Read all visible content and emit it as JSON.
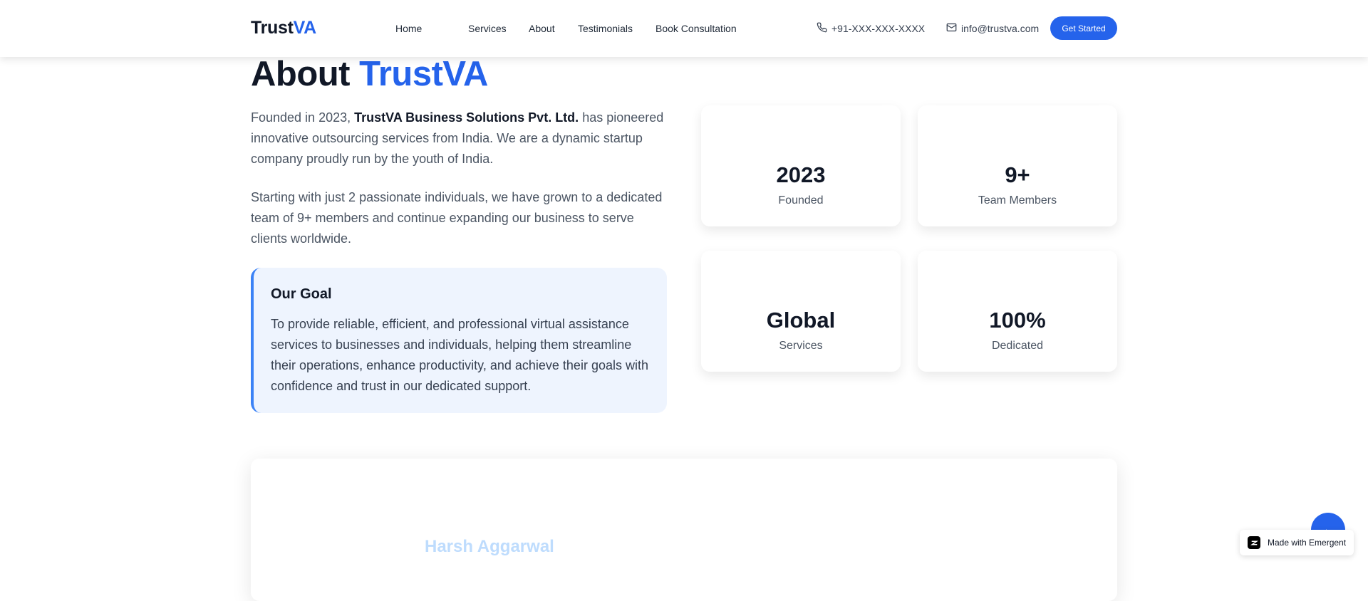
{
  "header": {
    "logo_part1": "Trust",
    "logo_part2": "VA",
    "nav": [
      {
        "label": "Home"
      },
      {
        "label": "Services"
      },
      {
        "label": "About"
      },
      {
        "label": "Testimonials"
      },
      {
        "label": "Book Consultation"
      }
    ],
    "phone": "+91-XXX-XXX-XXXX",
    "email": "info@trustva.com",
    "cta_label": "Get Started"
  },
  "about": {
    "title_part1": "About",
    "title_part2": "TrustVA",
    "p1_prefix": "Founded in 2023,",
    "p1_bold": "TrustVA Business Solutions Pvt. Ltd.",
    "p1_suffix": "has pioneered innovative outsourcing services from India. We are a dynamic startup company proudly run by the youth of India.",
    "p2": "Starting with just 2 passionate individuals, we have grown to a dedicated team of 9+ members and continue expanding our business to serve clients worldwide.",
    "goal_title": "Our Goal",
    "goal_text": "To provide reliable, efficient, and professional virtual assistance services to businesses and individuals, helping them streamline their operations, enhance productivity, and achieve their goals with confidence and trust in our dedicated support.",
    "stats": [
      {
        "value": "2023",
        "label": "Founded"
      },
      {
        "value": "9+",
        "label": "Team Members"
      },
      {
        "value": "Global",
        "label": "Services"
      },
      {
        "value": "100%",
        "label": "Dedicated"
      }
    ]
  },
  "team": {
    "name": "Harsh Aggarwal"
  },
  "badge": {
    "label": "Made with Emergent"
  },
  "colors": {
    "accent": "#2563eb",
    "goal_bg": "#eef4fe",
    "goal_border": "#3b82f6"
  },
  "icons": {
    "phone": "phone-icon",
    "mail": "mail-icon",
    "fab": "arrow-left-icon",
    "badge": "emergent-logo-icon"
  }
}
